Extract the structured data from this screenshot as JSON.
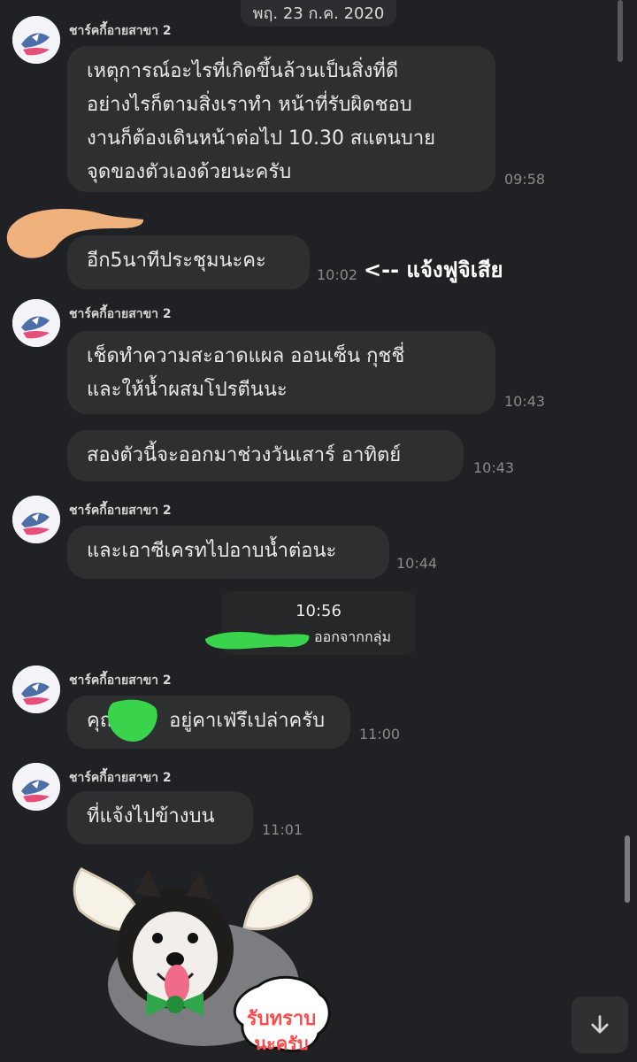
{
  "date_divider": "พฤ. 23 ก.ค. 2020",
  "messages": [
    {
      "sender": "ชาร์คกี้อายสาขา 2",
      "text_lines": [
        "เหตุการณ์อะไรที่เกิดขึ้นล้วนเป็นสิ่งที่ดี",
        "อย่างไรก็ตามสิ่งเราทำ หน้าที่รับผิดชอบ",
        "งานก็ต้องเดินหน้าต่อไป 10.30 สแตนบาย",
        "จุดของตัวเองด้วยนะครับ"
      ],
      "time": "09:58"
    },
    {
      "text": "อีก5นาทีประชุมนะคะ",
      "time": "10:02",
      "annotation": "<-- แจ้งฟูจิเสีย"
    },
    {
      "sender": "ชาร์คกี้อายสาขา 2",
      "text_lines": [
        "เช็ดทำความสะอาดแผล ออนเซ็น กุชชี่",
        "และให้น้ำผสมโปรตีนนะ"
      ],
      "time": "10:43"
    },
    {
      "text": "สองตัวนี้จะออกมาช่วงวันเสาร์ อาทิตย์",
      "time": "10:43"
    },
    {
      "sender": "ชาร์คกี้อายสาขา 2",
      "text": "และเอาซีเครทไปอาบน้ำต่อนะ",
      "time": "10:44"
    },
    {
      "system_time": "10:56",
      "system_text": "ออกจากกลุ่ม"
    },
    {
      "sender": "ชาร์คกี้อายสาขา 2",
      "text_prefix": "คุณ",
      "text_suffix": "อยู่คาเฟ่รึเปล่าครับ",
      "time": "11:00"
    },
    {
      "sender": "ชาร์คกี้อายสาขา 2",
      "text": "ที่แจ้งไปข้างบน",
      "time": "11:01"
    }
  ],
  "sticker": {
    "caption_line1": "รับทราบ",
    "caption_line2": "นะครับ"
  },
  "icons": {
    "avatar": "cartoon-avatar-icon",
    "scroll_down": "arrow-down-icon"
  },
  "colors": {
    "background": "#202124",
    "bubble": "#2e2f31",
    "scribble_orange": "#f2b07a",
    "scribble_green": "#39d44b",
    "sticker_bowtie": "#2fa64a"
  }
}
